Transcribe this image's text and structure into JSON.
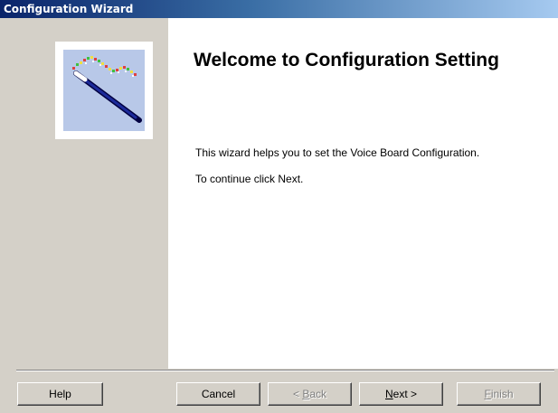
{
  "window": {
    "title": "Configuration Wizard"
  },
  "welcome": {
    "heading": "Welcome to Configuration Setting",
    "description": "This wizard helps you to set the Voice Board Configuration.",
    "instruction": "To continue click Next."
  },
  "buttons": {
    "help": "Help",
    "cancel": "Cancel",
    "back_prefix": "< ",
    "back_accel": "B",
    "back_rest": "ack",
    "next_accel": "N",
    "next_rest": "ext >",
    "finish_accel": "F",
    "finish_rest": "inish"
  },
  "button_states": {
    "back": "disabled",
    "next": "enabled",
    "finish": "disabled"
  },
  "icons": {
    "wizard_image": "magic-wand-icon"
  },
  "colors": {
    "titlebar_start": "#0a246a",
    "titlebar_end": "#a6caf0",
    "panel_background": "#d4d0c8",
    "content_background": "#ffffff",
    "disabled_text": "#808080"
  }
}
